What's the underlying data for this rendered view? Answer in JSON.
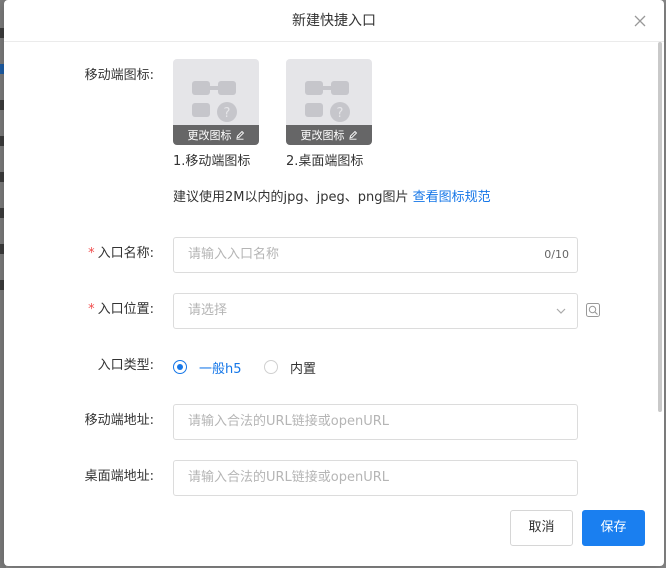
{
  "dialog": {
    "title": "新建快捷入口",
    "close_icon": "close-icon"
  },
  "icons": {
    "label": "移动端图标:",
    "cards": [
      {
        "change_label": "更改图标",
        "caption": "1.移动端图标"
      },
      {
        "change_label": "更改图标",
        "caption": "2.桌面端图标"
      }
    ],
    "tip_text": "建议使用2M以内的jpg、jpeg、png图片",
    "tip_link": "查看图标规范"
  },
  "form": {
    "name": {
      "label": "入口名称:",
      "required": "*",
      "placeholder": "请输入入口名称",
      "counter": "0/10"
    },
    "position": {
      "label": "入口位置:",
      "required": "*",
      "placeholder": "请选择"
    },
    "type": {
      "label": "入口类型:",
      "options": [
        {
          "label": "一般h5",
          "selected": true
        },
        {
          "label": "内置",
          "selected": false
        }
      ]
    },
    "mobile_url": {
      "label": "移动端地址:",
      "placeholder": "请输入合法的URL链接或openURL"
    },
    "desktop_url": {
      "label": "桌面端地址:",
      "placeholder": "请输入合法的URL链接或openURL"
    }
  },
  "footer": {
    "cancel_label": "取消",
    "save_label": "保存"
  },
  "colors": {
    "accent": "#1677e8",
    "required": "#f04b4b"
  }
}
